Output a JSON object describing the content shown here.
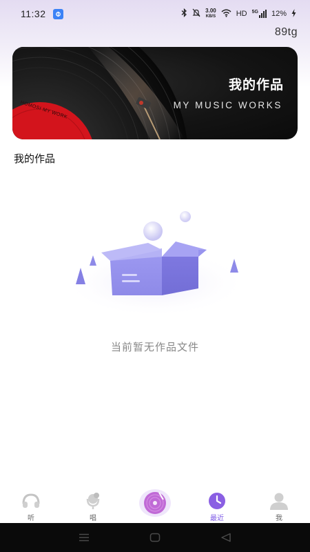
{
  "status_bar": {
    "time": "11:32",
    "net_speed_value": "3.00",
    "net_speed_unit": "KB/S",
    "hd": "HD",
    "network": "5G",
    "battery": "12%"
  },
  "user": {
    "id": "89tg"
  },
  "banner": {
    "title": "我的作品",
    "subtitle": "MY MUSIC WORKS",
    "record_label_text": "HOMOSI MY WORK"
  },
  "section": {
    "title": "我的作品"
  },
  "empty_state": {
    "message": "当前暂无作品文件"
  },
  "tabs": [
    {
      "label": "听",
      "icon": "headphones-icon",
      "active": false
    },
    {
      "label": "唱",
      "icon": "microphone-icon",
      "active": false
    },
    {
      "label": "",
      "icon": "vinyl-disc-icon",
      "active": false
    },
    {
      "label": "最近",
      "icon": "clock-icon",
      "active": true
    },
    {
      "label": "我",
      "icon": "user-icon",
      "active": false
    }
  ],
  "colors": {
    "accent": "#7d5ae6",
    "banner_bg": "#141414",
    "record_red": "#d3141c"
  }
}
